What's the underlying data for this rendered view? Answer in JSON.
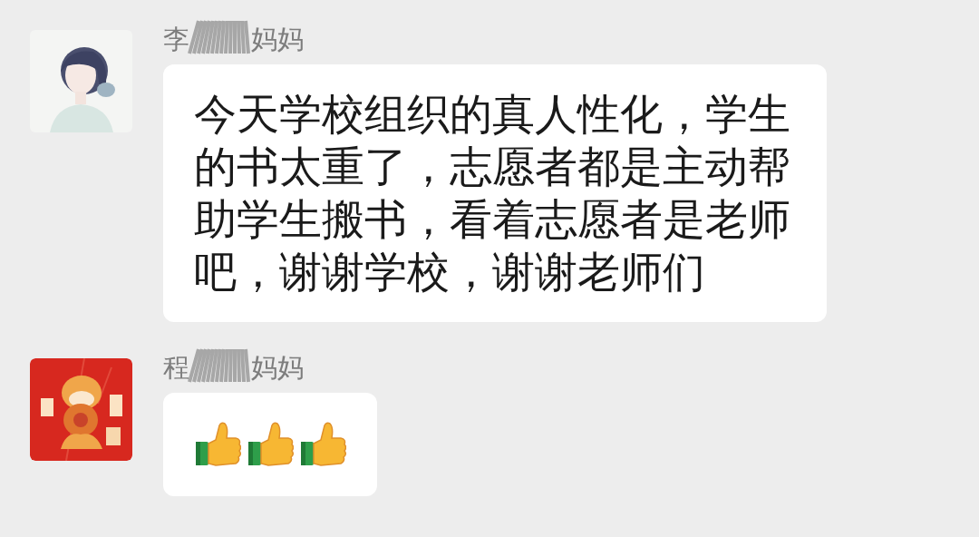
{
  "messages": [
    {
      "sender_parts": [
        "李",
        "妈妈"
      ],
      "sender_redacted": true,
      "avatar": {
        "kind": "picture"
      },
      "kind": "text",
      "text": "今天学校组织的真人性化，学生的书太重了，志愿者都是主动帮助学生搬书，看着志愿者是老师吧，谢谢学校，谢谢老师们"
    },
    {
      "sender_parts": [
        "程",
        "妈妈"
      ],
      "sender_redacted": true,
      "avatar": {
        "kind": "picture"
      },
      "kind": "emoji",
      "emojis": [
        {
          "kind": "thumbs-up"
        },
        {
          "kind": "thumbs-up"
        },
        {
          "kind": "thumbs-up"
        }
      ]
    }
  ]
}
